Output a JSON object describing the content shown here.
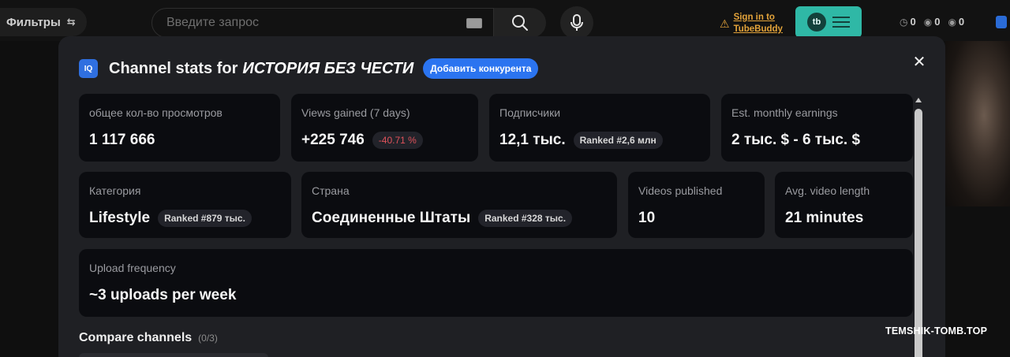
{
  "topbar": {
    "filters_label": "Фильтры",
    "search_placeholder": "Введите запрос",
    "tubebuddy_signin": "Sign in to TubeBuddy",
    "tubebuddy_logo": "tb",
    "counters": [
      {
        "icon": "clock-icon",
        "value": "0"
      },
      {
        "icon": "eye-icon",
        "value": "0"
      },
      {
        "icon": "eye-icon",
        "value": "0"
      }
    ]
  },
  "modal": {
    "badge": "IQ",
    "title_prefix": "Channel stats for",
    "channel_name": "ИСТОРИЯ БЕЗ ЧЕСТИ",
    "add_competitor_label": "Добавить конкурента",
    "close_icon": "close-icon",
    "cards": {
      "total_views": {
        "label": "общее кол-во просмотров",
        "value": "1 117 666"
      },
      "views_gained": {
        "label": "Views gained (7 days)",
        "value": "+225 746",
        "change": "-40.71 %"
      },
      "subscribers": {
        "label": "Подписчики",
        "value": "12,1 тыс.",
        "rank": "Ranked #2,6 млн"
      },
      "earnings": {
        "label": "Est. monthly earnings",
        "value": "2 тыс. $ - 6 тыс. $"
      },
      "category": {
        "label": "Категория",
        "value": "Lifestyle",
        "rank": "Ranked #879 тыс."
      },
      "country": {
        "label": "Страна",
        "value": "Соединенные Штаты",
        "rank": "Ranked #328 тыс."
      },
      "videos_published": {
        "label": "Videos published",
        "value": "10"
      },
      "avg_length": {
        "label": "Avg. video length",
        "value": "21 minutes"
      },
      "upload_frequency": {
        "label": "Upload frequency",
        "value": "~3 uploads per week"
      }
    },
    "compare": {
      "title": "Compare channels",
      "count": "(0/3)"
    }
  },
  "watermark": "TEMSHIK-TOMB.TOP",
  "colors": {
    "accent": "#2b74f0",
    "tubebuddy": "#2fb8a6",
    "negative": "#e0525b",
    "modal_bg": "#1f2024",
    "card_bg": "#0b0c10"
  }
}
